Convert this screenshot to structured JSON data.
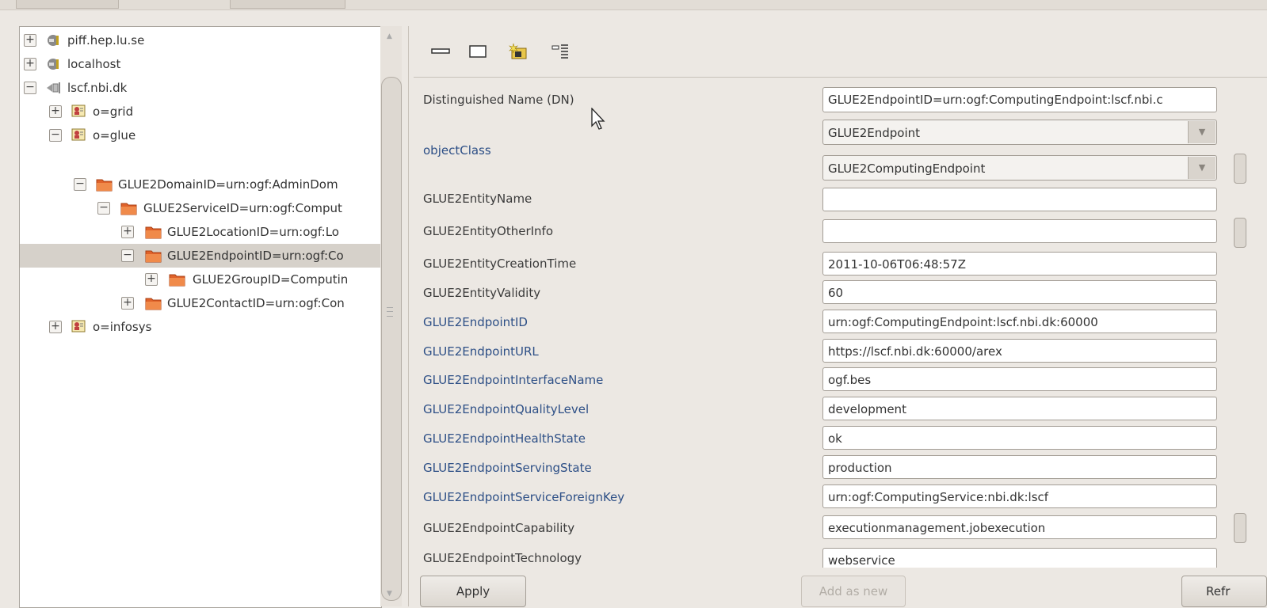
{
  "tree": {
    "items": [
      {
        "label": "piff.hep.lu.se",
        "expander": "+",
        "icon": "server-plug-icon"
      },
      {
        "label": "localhost",
        "expander": "+",
        "icon": "server-plug-icon"
      },
      {
        "label": "lscf.nbi.dk",
        "expander": "−",
        "icon": "server-unplug-icon"
      },
      {
        "label": "o=grid",
        "expander": "+",
        "icon": "ldap-org-icon"
      },
      {
        "label": "o=glue",
        "expander": "−",
        "icon": "ldap-org-icon"
      },
      {
        "label": "GLUE2DomainID=urn:ogf:AdminDom",
        "expander": "−",
        "icon": "folder-icon"
      },
      {
        "label": "GLUE2ServiceID=urn:ogf:Comput",
        "expander": "−",
        "icon": "folder-icon"
      },
      {
        "label": "GLUE2LocationID=urn:ogf:Lo",
        "expander": "+",
        "icon": "folder-icon"
      },
      {
        "label": "GLUE2EndpointID=urn:ogf:Co",
        "expander": "−",
        "icon": "folder-icon",
        "selected": true
      },
      {
        "label": "GLUE2GroupID=Computin",
        "expander": "+",
        "icon": "folder-icon"
      },
      {
        "label": "GLUE2ContactID=urn:ogf:Con",
        "expander": "+",
        "icon": "folder-icon"
      },
      {
        "label": "o=infosys",
        "expander": "+",
        "icon": "ldap-org-icon"
      }
    ]
  },
  "toolbar": {
    "icons": [
      "minimize-icon",
      "maximize-icon",
      "new-entry-icon",
      "attribute-list-icon"
    ]
  },
  "attributes": {
    "dn_label": "Distinguished Name (DN)",
    "dn_value": "GLUE2EndpointID=urn:ogf:ComputingEndpoint:lscf.nbi.c",
    "objectclass_label": "objectClass",
    "objectclass_values": [
      "GLUE2Endpoint",
      "GLUE2ComputingEndpoint"
    ],
    "rows": [
      {
        "label": "GLUE2EntityName",
        "value": "",
        "color": "dark"
      },
      {
        "label": "GLUE2EntityOtherInfo",
        "value": "",
        "color": "dark"
      },
      {
        "label": "GLUE2EntityCreationTime",
        "value": "2011-10-06T06:48:57Z",
        "color": "dark"
      },
      {
        "label": "GLUE2EntityValidity",
        "value": "60",
        "color": "dark"
      },
      {
        "label": "GLUE2EndpointID",
        "value": "urn:ogf:ComputingEndpoint:lscf.nbi.dk:60000",
        "color": "blue"
      },
      {
        "label": "GLUE2EndpointURL",
        "value": "https://lscf.nbi.dk:60000/arex",
        "color": "blue"
      },
      {
        "label": "GLUE2EndpointInterfaceName",
        "value": "ogf.bes",
        "color": "blue"
      },
      {
        "label": "GLUE2EndpointQualityLevel",
        "value": "development",
        "color": "blue"
      },
      {
        "label": "GLUE2EndpointHealthState",
        "value": "ok",
        "color": "blue"
      },
      {
        "label": "GLUE2EndpointServingState",
        "value": "production",
        "color": "blue"
      },
      {
        "label": "GLUE2EndpointServiceForeignKey",
        "value": "urn:ogf:ComputingService:nbi.dk:lscf",
        "color": "blue"
      },
      {
        "label": "GLUE2EndpointCapability",
        "value": "executionmanagement.jobexecution",
        "color": "dark"
      },
      {
        "label": "GLUE2EndpointTechnology",
        "value": "webservice",
        "color": "dark"
      }
    ]
  },
  "buttons": {
    "apply": "Apply",
    "add_as_new": "Add as new",
    "refresh": "Refr"
  },
  "colors": {
    "label_blue": "#2d4f86",
    "folder_orange": "#e0622a",
    "selection": "#d6d1ca"
  }
}
